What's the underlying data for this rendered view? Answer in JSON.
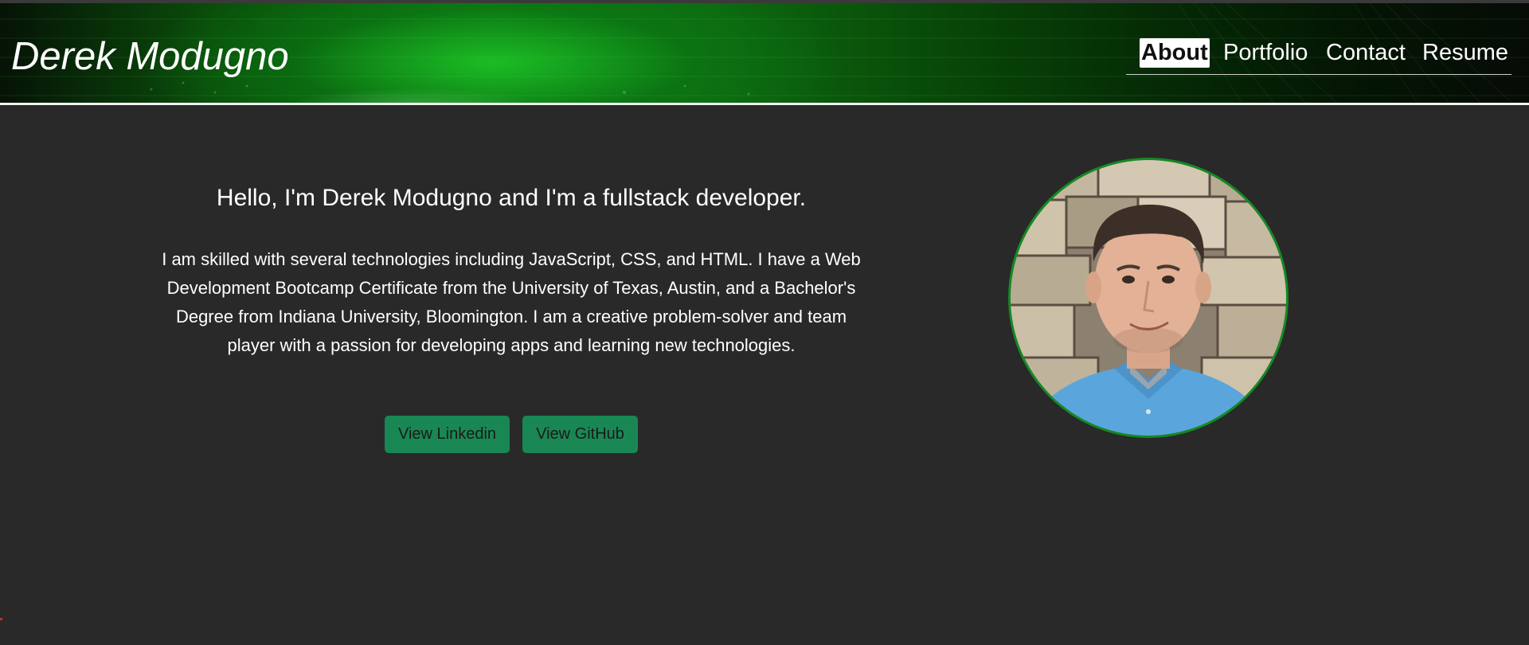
{
  "header": {
    "brand": "Derek Modugno",
    "nav": [
      {
        "label": "About",
        "active": true
      },
      {
        "label": "Portfolio",
        "active": false
      },
      {
        "label": "Contact",
        "active": false
      },
      {
        "label": "Resume",
        "active": false
      }
    ]
  },
  "intro": {
    "title": "Hello, I'm Derek Modugno and I'm a fullstack developer.",
    "text": "I am skilled with several technologies including JavaScript, CSS, and HTML. I have a Web Development Bootcamp Certificate from the University of Texas, Austin, and a Bachelor's Degree from Indiana University, Bloomington. I am a creative problem-solver and team player with a passion for developing apps and learning new technologies.",
    "buttons": {
      "linkedin": "View Linkedin",
      "github": "View GitHub"
    }
  },
  "colors": {
    "background": "#292929",
    "accent": "#198754",
    "header_green": "#0e7b12",
    "avatar_border": "#138a22"
  },
  "icons": {
    "avatar": "profile-photo"
  }
}
